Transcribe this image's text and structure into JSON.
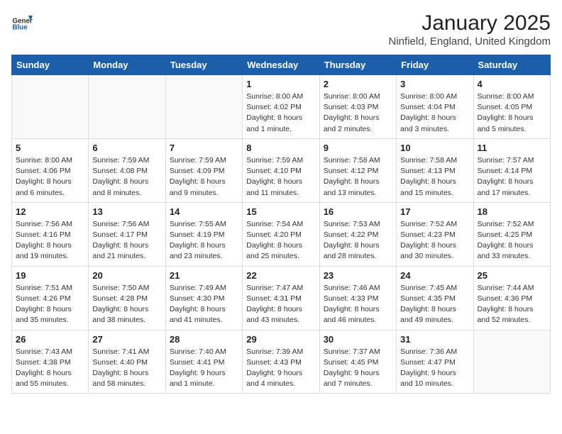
{
  "header": {
    "logo": {
      "general": "General",
      "blue": "Blue"
    },
    "title": "January 2025",
    "subtitle": "Ninfield, England, United Kingdom"
  },
  "days_of_week": [
    "Sunday",
    "Monday",
    "Tuesday",
    "Wednesday",
    "Thursday",
    "Friday",
    "Saturday"
  ],
  "weeks": [
    [
      {
        "day": "",
        "info": ""
      },
      {
        "day": "",
        "info": ""
      },
      {
        "day": "",
        "info": ""
      },
      {
        "day": "1",
        "info": "Sunrise: 8:00 AM\nSunset: 4:02 PM\nDaylight: 8 hours\nand 1 minute."
      },
      {
        "day": "2",
        "info": "Sunrise: 8:00 AM\nSunset: 4:03 PM\nDaylight: 8 hours\nand 2 minutes."
      },
      {
        "day": "3",
        "info": "Sunrise: 8:00 AM\nSunset: 4:04 PM\nDaylight: 8 hours\nand 3 minutes."
      },
      {
        "day": "4",
        "info": "Sunrise: 8:00 AM\nSunset: 4:05 PM\nDaylight: 8 hours\nand 5 minutes."
      }
    ],
    [
      {
        "day": "5",
        "info": "Sunrise: 8:00 AM\nSunset: 4:06 PM\nDaylight: 8 hours\nand 6 minutes."
      },
      {
        "day": "6",
        "info": "Sunrise: 7:59 AM\nSunset: 4:08 PM\nDaylight: 8 hours\nand 8 minutes."
      },
      {
        "day": "7",
        "info": "Sunrise: 7:59 AM\nSunset: 4:09 PM\nDaylight: 8 hours\nand 9 minutes."
      },
      {
        "day": "8",
        "info": "Sunrise: 7:59 AM\nSunset: 4:10 PM\nDaylight: 8 hours\nand 11 minutes."
      },
      {
        "day": "9",
        "info": "Sunrise: 7:58 AM\nSunset: 4:12 PM\nDaylight: 8 hours\nand 13 minutes."
      },
      {
        "day": "10",
        "info": "Sunrise: 7:58 AM\nSunset: 4:13 PM\nDaylight: 8 hours\nand 15 minutes."
      },
      {
        "day": "11",
        "info": "Sunrise: 7:57 AM\nSunset: 4:14 PM\nDaylight: 8 hours\nand 17 minutes."
      }
    ],
    [
      {
        "day": "12",
        "info": "Sunrise: 7:56 AM\nSunset: 4:16 PM\nDaylight: 8 hours\nand 19 minutes."
      },
      {
        "day": "13",
        "info": "Sunrise: 7:56 AM\nSunset: 4:17 PM\nDaylight: 8 hours\nand 21 minutes."
      },
      {
        "day": "14",
        "info": "Sunrise: 7:55 AM\nSunset: 4:19 PM\nDaylight: 8 hours\nand 23 minutes."
      },
      {
        "day": "15",
        "info": "Sunrise: 7:54 AM\nSunset: 4:20 PM\nDaylight: 8 hours\nand 25 minutes."
      },
      {
        "day": "16",
        "info": "Sunrise: 7:53 AM\nSunset: 4:22 PM\nDaylight: 8 hours\nand 28 minutes."
      },
      {
        "day": "17",
        "info": "Sunrise: 7:52 AM\nSunset: 4:23 PM\nDaylight: 8 hours\nand 30 minutes."
      },
      {
        "day": "18",
        "info": "Sunrise: 7:52 AM\nSunset: 4:25 PM\nDaylight: 8 hours\nand 33 minutes."
      }
    ],
    [
      {
        "day": "19",
        "info": "Sunrise: 7:51 AM\nSunset: 4:26 PM\nDaylight: 8 hours\nand 35 minutes."
      },
      {
        "day": "20",
        "info": "Sunrise: 7:50 AM\nSunset: 4:28 PM\nDaylight: 8 hours\nand 38 minutes."
      },
      {
        "day": "21",
        "info": "Sunrise: 7:49 AM\nSunset: 4:30 PM\nDaylight: 8 hours\nand 41 minutes."
      },
      {
        "day": "22",
        "info": "Sunrise: 7:47 AM\nSunset: 4:31 PM\nDaylight: 8 hours\nand 43 minutes."
      },
      {
        "day": "23",
        "info": "Sunrise: 7:46 AM\nSunset: 4:33 PM\nDaylight: 8 hours\nand 46 minutes."
      },
      {
        "day": "24",
        "info": "Sunrise: 7:45 AM\nSunset: 4:35 PM\nDaylight: 8 hours\nand 49 minutes."
      },
      {
        "day": "25",
        "info": "Sunrise: 7:44 AM\nSunset: 4:36 PM\nDaylight: 8 hours\nand 52 minutes."
      }
    ],
    [
      {
        "day": "26",
        "info": "Sunrise: 7:43 AM\nSunset: 4:38 PM\nDaylight: 8 hours\nand 55 minutes."
      },
      {
        "day": "27",
        "info": "Sunrise: 7:41 AM\nSunset: 4:40 PM\nDaylight: 8 hours\nand 58 minutes."
      },
      {
        "day": "28",
        "info": "Sunrise: 7:40 AM\nSunset: 4:41 PM\nDaylight: 9 hours\nand 1 minute."
      },
      {
        "day": "29",
        "info": "Sunrise: 7:39 AM\nSunset: 4:43 PM\nDaylight: 9 hours\nand 4 minutes."
      },
      {
        "day": "30",
        "info": "Sunrise: 7:37 AM\nSunset: 4:45 PM\nDaylight: 9 hours\nand 7 minutes."
      },
      {
        "day": "31",
        "info": "Sunrise: 7:36 AM\nSunset: 4:47 PM\nDaylight: 9 hours\nand 10 minutes."
      },
      {
        "day": "",
        "info": ""
      }
    ]
  ]
}
